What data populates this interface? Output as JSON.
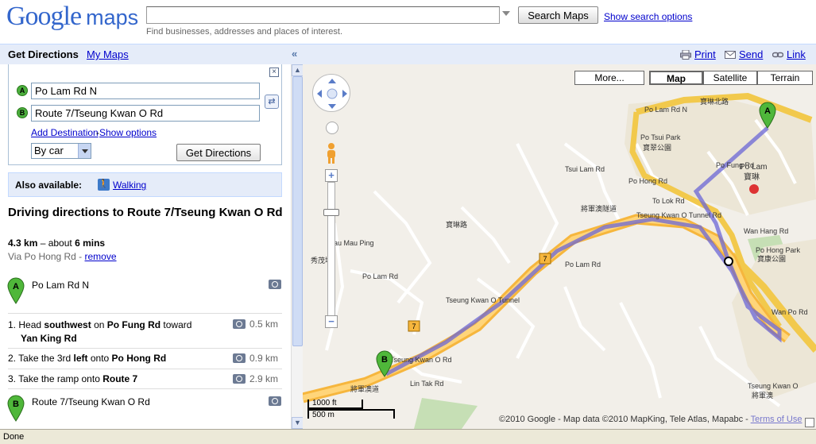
{
  "header": {
    "logo_google": "Google",
    "logo_maps": "maps",
    "search_value": "",
    "search_button": "Search Maps",
    "search_options": "Show search options",
    "search_hint": "Find businesses, addresses and places of interest."
  },
  "toolbar": {
    "get_directions_tab": "Get Directions",
    "my_maps_tab": "My Maps",
    "collapse": "«",
    "print": "Print",
    "send": "Send",
    "link": "Link"
  },
  "form": {
    "close": "×",
    "origin_marker": "A",
    "destination_marker": "B",
    "origin_value": "Po Lam Rd N",
    "destination_value": "Route 7/Tseung Kwan O Rd",
    "add_destination": "Add Destination",
    "separator": "-",
    "show_options": "Show options",
    "mode": "By car",
    "get_directions_button": "Get Directions"
  },
  "also": {
    "label": "Also available:",
    "walking": "Walking"
  },
  "route": {
    "title": "Driving directions to Route 7/Tseung Kwan O Rd",
    "distance": "4.3 km",
    "time_sep": "– about",
    "time": "6 mins",
    "via": "Via Po Hong Rd -",
    "remove": "remove",
    "start_label": "Po Lam Rd N",
    "end_label": "Route 7/Tseung Kwan O Rd",
    "steps": [
      {
        "num": "1.",
        "a": "Head ",
        "b1": "southwest",
        "c": " on ",
        "b2": "Po Fung Rd",
        "d": " toward",
        "b3": "Yan King Rd",
        "dist": "0.5 km"
      },
      {
        "num": "2.",
        "a": "Take the 3rd ",
        "b1": "left",
        "c": " onto ",
        "b2": "Po Hong Rd",
        "dist": "0.9 km"
      },
      {
        "num": "3.",
        "a": "Take the ramp onto ",
        "b2": "Route 7",
        "dist": "2.9 km"
      }
    ]
  },
  "map": {
    "type_more": "More...",
    "type_map": "Map",
    "type_satellite": "Satellite",
    "type_terrain": "Terrain",
    "copyright": "©2010 Google - Map data ©2010 MapKing, Tele Atlas, Mapabc - ",
    "terms": "Terms of Use",
    "scale_ft": "1000 ft",
    "scale_m": "500 m",
    "labels": {
      "po_lam_rd_n": "Po Lam Rd N",
      "po_lam_n_cn": "寶琳北路",
      "po_hong_rd": "Po Hong Rd",
      "po_tsui_park": "Po Tsui Park",
      "po_tsui_park_cn": "寶翠公園",
      "po_fung_rd": "Po Fung Rd",
      "po_lam": "Po Lam",
      "po_lam_cn": "寶琳",
      "wan_hang_rd": "Wan Hang Rd",
      "po_hong_park": "Po Hong Park",
      "po_hong_park_cn": "寶康公園",
      "tko_tunnel_rd": "Tseung Kwan O Tunnel Rd",
      "tko_tunnel": "Tseung Kwan O Tunnel",
      "tko_tunnel_cn": "將軍澳隧道",
      "tko_rd": "Tseung Kwan O Rd",
      "tko_rd_cn": "將軍澳道",
      "wan_po_rd": "Wan Po Rd",
      "po_lam_rd": "Po Lam Rd",
      "po_lam_rd_cn": "寶琳路",
      "sau_mau_ping": "Sau Mau Ping",
      "sau_mau_ping_cn": "秀茂坪",
      "lin_tak_rd": "Lin Tak Rd",
      "tsui_lam_rd": "Tsui Lam Rd",
      "to_lok_rd": "To Lok Rd",
      "hang_hau": "Tseung Kwan O",
      "hang_hau_cn": "將軍澳",
      "route7": "7",
      "mtr_a": "A",
      "mtr_b": "B"
    }
  }
}
